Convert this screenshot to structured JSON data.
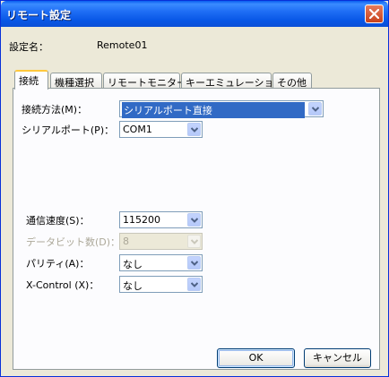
{
  "window": {
    "title": "リモート設定"
  },
  "setting": {
    "label": "設定名：",
    "value": "Remote01"
  },
  "tabs": [
    {
      "label": "接続"
    },
    {
      "label": "機種選択"
    },
    {
      "label": "リモートモニター"
    },
    {
      "label": "キーエミュレーション"
    },
    {
      "label": "その他"
    }
  ],
  "fields": {
    "method": {
      "label": "接続方法(M)：",
      "value": "シリアルポート直接"
    },
    "port": {
      "label": "シリアルポート(P)：",
      "value": "COM1"
    },
    "speed": {
      "label": "通信速度(S)：",
      "value": "115200"
    },
    "databits": {
      "label": "データビット数(D)：",
      "value": "8"
    },
    "parity": {
      "label": "パリティ(A)：",
      "value": "なし"
    },
    "xcontrol": {
      "label": "X-Control (X)：",
      "value": "なし"
    }
  },
  "buttons": {
    "ok": "OK",
    "cancel": "キャンセル"
  },
  "colors": {
    "title_bar": "#0a5ef0",
    "close_button": "#c8411b",
    "selection": "#316ac5",
    "tab_highlight": "#ffc83c"
  }
}
